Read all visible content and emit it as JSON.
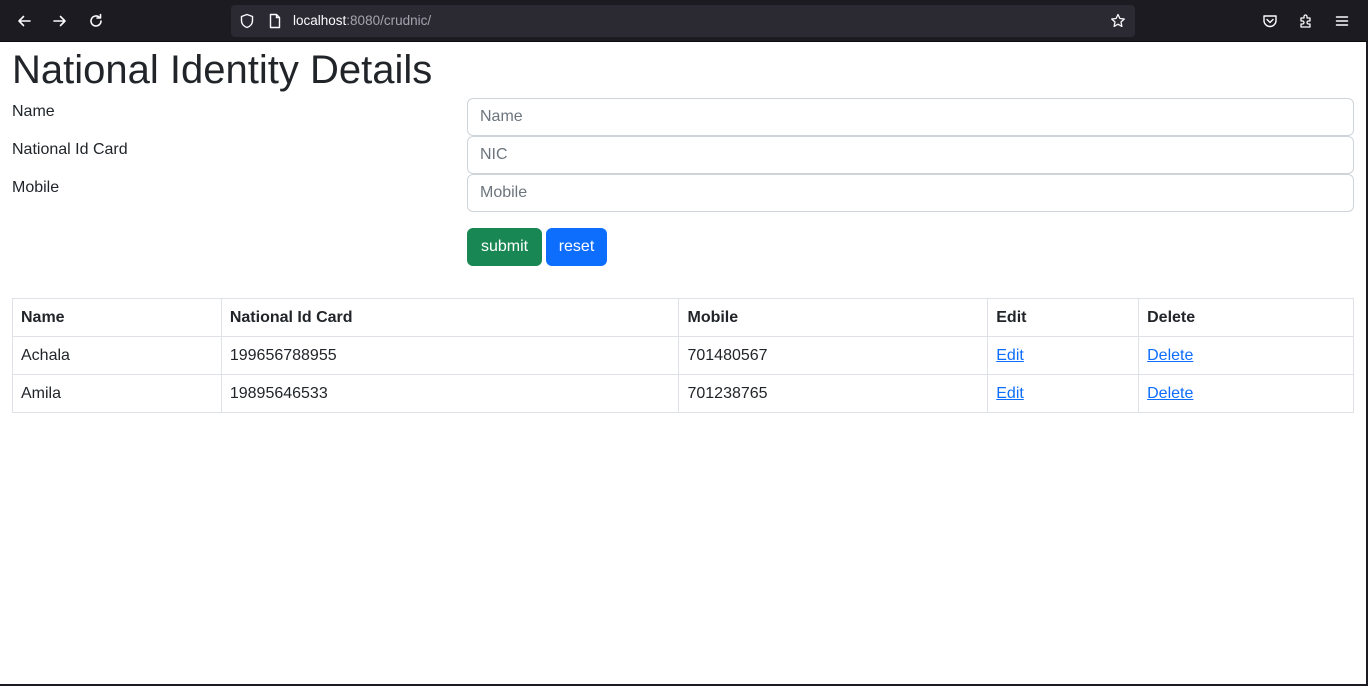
{
  "browser": {
    "url_host": "localhost",
    "url_rest": ":8080/crudnic/"
  },
  "page": {
    "title": "National Identity Details"
  },
  "form": {
    "name_label": "Name",
    "name_placeholder": "Name",
    "nic_label": "National Id Card",
    "nic_placeholder": "NIC",
    "mobile_label": "Mobile",
    "mobile_placeholder": "Mobile",
    "submit_label": "submit",
    "reset_label": "reset"
  },
  "table": {
    "headers": [
      "Name",
      "National Id Card",
      "Mobile",
      "Edit",
      "Delete"
    ],
    "rows": [
      {
        "name": "Achala",
        "nic": "199656788955",
        "mobile": "701480567",
        "edit": "Edit",
        "delete": "Delete"
      },
      {
        "name": "Amila",
        "nic": "19895646533",
        "mobile": "701238765",
        "edit": "Edit",
        "delete": "Delete"
      }
    ]
  },
  "colors": {
    "submit": "#198754",
    "reset": "#0d6efd",
    "link": "#0d6efd"
  }
}
